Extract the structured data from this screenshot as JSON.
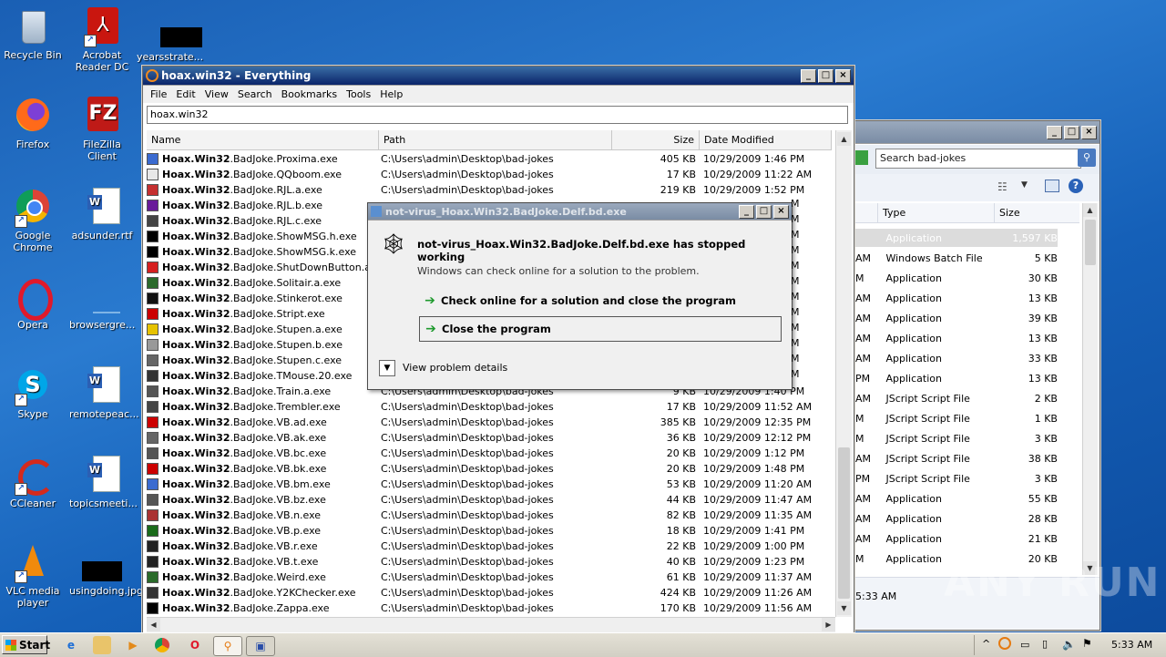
{
  "desktop": {
    "icons_left": [
      "Recycle Bin",
      "Firefox",
      "Google Chrome",
      "Opera",
      "Skype",
      "CCleaner",
      "VLC media player"
    ],
    "icons_right": [
      "Acrobat Reader DC",
      "FileZilla Client",
      "adsunder.rtf",
      "browsergre...",
      "remotepeac...",
      "topicsmeeti...",
      "usingdoing.jpg"
    ],
    "icon_top": "yearsstrate..."
  },
  "everything": {
    "title": "hoax.win32 - Everything",
    "menu": [
      "File",
      "Edit",
      "View",
      "Search",
      "Bookmarks",
      "Tools",
      "Help"
    ],
    "search_value": "hoax.win32",
    "columns": [
      "Name",
      "Path",
      "Size",
      "Date Modified"
    ],
    "rows": [
      {
        "bold": "Hoax.Win32",
        "rest": ".BadJoke.Proxima.exe",
        "path": "C:\\Users\\admin\\Desktop\\bad-jokes",
        "size": "405 KB",
        "date": "10/29/2009 1:46 PM"
      },
      {
        "bold": "Hoax.Win32",
        "rest": ".BadJoke.QQboom.exe",
        "path": "C:\\Users\\admin\\Desktop\\bad-jokes",
        "size": "17 KB",
        "date": "10/29/2009 11:22 AM"
      },
      {
        "bold": "Hoax.Win32",
        "rest": ".BadJoke.RJL.a.exe",
        "path": "C:\\Users\\admin\\Desktop\\bad-jokes",
        "size": "219 KB",
        "date": "10/29/2009 1:52 PM"
      },
      {
        "bold": "Hoax.Win32",
        "rest": ".BadJoke.RJL.b.exe",
        "path": "",
        "size": "",
        "date": ""
      },
      {
        "bold": "Hoax.Win32",
        "rest": ".BadJoke.RJL.c.exe",
        "path": "",
        "size": "",
        "date": ""
      },
      {
        "bold": "Hoax.Win32",
        "rest": ".BadJoke.ShowMSG.h.exe",
        "path": "",
        "size": "",
        "date": ""
      },
      {
        "bold": "Hoax.Win32",
        "rest": ".BadJoke.ShowMSG.k.exe",
        "path": "",
        "size": "",
        "date": ""
      },
      {
        "bold": "Hoax.Win32",
        "rest": ".BadJoke.ShutDownButton.a.ex",
        "path": "",
        "size": "",
        "date": ""
      },
      {
        "bold": "Hoax.Win32",
        "rest": ".BadJoke.Solitair.a.exe",
        "path": "",
        "size": "",
        "date": ""
      },
      {
        "bold": "Hoax.Win32",
        "rest": ".BadJoke.Stinkerot.exe",
        "path": "",
        "size": "",
        "date": ""
      },
      {
        "bold": "Hoax.Win32",
        "rest": ".BadJoke.Stript.exe",
        "path": "",
        "size": "",
        "date": ""
      },
      {
        "bold": "Hoax.Win32",
        "rest": ".BadJoke.Stupen.a.exe",
        "path": "",
        "size": "",
        "date": ""
      },
      {
        "bold": "Hoax.Win32",
        "rest": ".BadJoke.Stupen.b.exe",
        "path": "",
        "size": "",
        "date": ""
      },
      {
        "bold": "Hoax.Win32",
        "rest": ".BadJoke.Stupen.c.exe",
        "path": "",
        "size": "",
        "date": ""
      },
      {
        "bold": "Hoax.Win32",
        "rest": ".BadJoke.TMouse.20.exe",
        "path": "",
        "size": "",
        "date": ""
      },
      {
        "bold": "Hoax.Win32",
        "rest": ".BadJoke.Train.a.exe",
        "path": "C:\\Users\\admin\\Desktop\\bad-jokes",
        "size": "9 KB",
        "date": "10/29/2009 1:40 PM"
      },
      {
        "bold": "Hoax.Win32",
        "rest": ".BadJoke.Trembler.exe",
        "path": "C:\\Users\\admin\\Desktop\\bad-jokes",
        "size": "17 KB",
        "date": "10/29/2009 11:52 AM"
      },
      {
        "bold": "Hoax.Win32",
        "rest": ".BadJoke.VB.ad.exe",
        "path": "C:\\Users\\admin\\Desktop\\bad-jokes",
        "size": "385 KB",
        "date": "10/29/2009 12:35 PM"
      },
      {
        "bold": "Hoax.Win32",
        "rest": ".BadJoke.VB.ak.exe",
        "path": "C:\\Users\\admin\\Desktop\\bad-jokes",
        "size": "36 KB",
        "date": "10/29/2009 12:12 PM"
      },
      {
        "bold": "Hoax.Win32",
        "rest": ".BadJoke.VB.bc.exe",
        "path": "C:\\Users\\admin\\Desktop\\bad-jokes",
        "size": "20 KB",
        "date": "10/29/2009 1:12 PM"
      },
      {
        "bold": "Hoax.Win32",
        "rest": ".BadJoke.VB.bk.exe",
        "path": "C:\\Users\\admin\\Desktop\\bad-jokes",
        "size": "20 KB",
        "date": "10/29/2009 1:48 PM"
      },
      {
        "bold": "Hoax.Win32",
        "rest": ".BadJoke.VB.bm.exe",
        "path": "C:\\Users\\admin\\Desktop\\bad-jokes",
        "size": "53 KB",
        "date": "10/29/2009 11:20 AM"
      },
      {
        "bold": "Hoax.Win32",
        "rest": ".BadJoke.VB.bz.exe",
        "path": "C:\\Users\\admin\\Desktop\\bad-jokes",
        "size": "44 KB",
        "date": "10/29/2009 11:47 AM"
      },
      {
        "bold": "Hoax.Win32",
        "rest": ".BadJoke.VB.n.exe",
        "path": "C:\\Users\\admin\\Desktop\\bad-jokes",
        "size": "82 KB",
        "date": "10/29/2009 11:35 AM"
      },
      {
        "bold": "Hoax.Win32",
        "rest": ".BadJoke.VB.p.exe",
        "path": "C:\\Users\\admin\\Desktop\\bad-jokes",
        "size": "18 KB",
        "date": "10/29/2009 1:41 PM"
      },
      {
        "bold": "Hoax.Win32",
        "rest": ".BadJoke.VB.r.exe",
        "path": "C:\\Users\\admin\\Desktop\\bad-jokes",
        "size": "22 KB",
        "date": "10/29/2009 1:00 PM"
      },
      {
        "bold": "Hoax.Win32",
        "rest": ".BadJoke.VB.t.exe",
        "path": "C:\\Users\\admin\\Desktop\\bad-jokes",
        "size": "40 KB",
        "date": "10/29/2009 1:23 PM"
      },
      {
        "bold": "Hoax.Win32",
        "rest": ".BadJoke.Weird.exe",
        "path": "C:\\Users\\admin\\Desktop\\bad-jokes",
        "size": "61 KB",
        "date": "10/29/2009 11:37 AM"
      },
      {
        "bold": "Hoax.Win32",
        "rest": ".BadJoke.Y2KChecker.exe",
        "path": "C:\\Users\\admin\\Desktop\\bad-jokes",
        "size": "424 KB",
        "date": "10/29/2009 11:26 AM"
      },
      {
        "bold": "Hoax.Win32",
        "rest": ".BadJoke.Zappa.exe",
        "path": "C:\\Users\\admin\\Desktop\\bad-jokes",
        "size": "170 KB",
        "date": "10/29/2009 11:56 AM"
      }
    ],
    "right_col_fragments": [
      "M",
      "M",
      "M",
      "M",
      "M",
      "M",
      "M",
      "M",
      "M",
      "M",
      "M",
      "M"
    ]
  },
  "explorer": {
    "search_placeholder": "Search bad-jokes",
    "columns": [
      "Type",
      "Size"
    ],
    "rows": [
      {
        "pre": "",
        "type": "Application",
        "size": "1,597 KB"
      },
      {
        "pre": "AM",
        "type": "Windows Batch File",
        "size": "5 KB"
      },
      {
        "pre": "M",
        "type": "Application",
        "size": "30 KB"
      },
      {
        "pre": "AM",
        "type": "Application",
        "size": "13 KB"
      },
      {
        "pre": "AM",
        "type": "Application",
        "size": "39 KB"
      },
      {
        "pre": "AM",
        "type": "Application",
        "size": "13 KB"
      },
      {
        "pre": "AM",
        "type": "Application",
        "size": "33 KB"
      },
      {
        "pre": "PM",
        "type": "Application",
        "size": "13 KB"
      },
      {
        "pre": "AM",
        "type": "JScript Script File",
        "size": "2 KB"
      },
      {
        "pre": "M",
        "type": "JScript Script File",
        "size": "1 KB"
      },
      {
        "pre": "M",
        "type": "JScript Script File",
        "size": "3 KB"
      },
      {
        "pre": "AM",
        "type": "JScript Script File",
        "size": "38 KB"
      },
      {
        "pre": "PM",
        "type": "JScript Script File",
        "size": "3 KB"
      },
      {
        "pre": "AM",
        "type": "Application",
        "size": "55 KB"
      },
      {
        "pre": "AM",
        "type": "Application",
        "size": "28 KB"
      },
      {
        "pre": "AM",
        "type": "Application",
        "size": "21 KB"
      },
      {
        "pre": "M",
        "type": "Application",
        "size": "20 KB"
      }
    ],
    "status_time": "5:33 AM"
  },
  "dialog": {
    "title": "not-virus_Hoax.Win32.BadJoke.Delf.bd.exe",
    "heading": "not-virus_Hoax.Win32.BadJoke.Delf.bd.exe has stopped working",
    "subtext": "Windows can check online for a solution to the problem.",
    "option1": "Check online for a solution and close the program",
    "option2": "Close the program",
    "details": "View problem details"
  },
  "taskbar": {
    "start": "Start",
    "clock": "5:33 AM"
  },
  "watermark": "ANY RUN"
}
